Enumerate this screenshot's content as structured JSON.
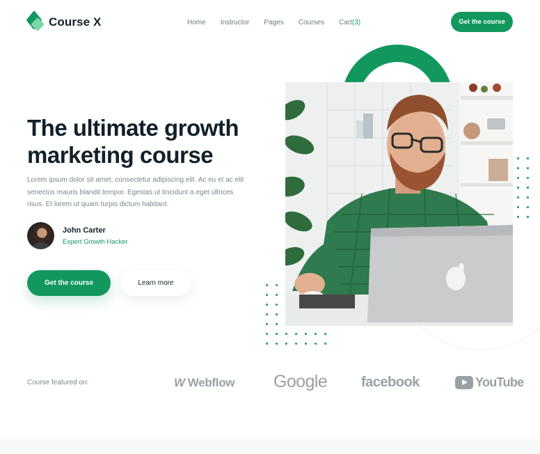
{
  "brand": {
    "name": "Course X",
    "colors": {
      "accent": "#12985f",
      "accent_light": "#7fd6a8",
      "text": "#13202a",
      "muted": "#7b868c"
    }
  },
  "nav": {
    "items": [
      {
        "label": "Home"
      },
      {
        "label": "Instructor"
      },
      {
        "label": "Pages"
      },
      {
        "label": "Courses"
      }
    ],
    "cart_label": "Cart",
    "cart_count": "(3)",
    "cta_label": "Get the course"
  },
  "hero": {
    "title": "The ultimate growth marketing course",
    "description": "Lorem ipsum dolor sit amet, consectetur adipiscing elit. Ac eu et ac elit senectus mauris blandit tempor. Egestas ut tincidunt a eget ultrices risus. Et lorem ut quam turpis dictum habitant.",
    "author": {
      "name": "John Carter",
      "role": "Expert Growth Hacker"
    },
    "primary_cta": "Get the course",
    "secondary_cta": "Learn more"
  },
  "featured": {
    "label": "Course featured on:",
    "brands": [
      "Webflow",
      "Google",
      "facebook",
      "YouTube"
    ]
  },
  "icons": {
    "logo": "course-x-logo-icon",
    "webflow": "webflow-logo-icon",
    "youtube": "youtube-play-icon"
  }
}
